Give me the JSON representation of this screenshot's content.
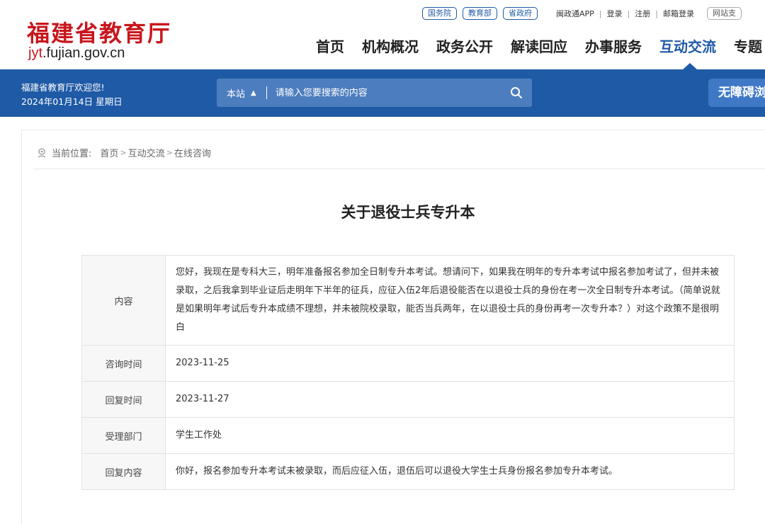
{
  "header": {
    "logo_cn": "福建省教育厅",
    "logo_domain_accent": "jyt",
    "logo_domain_rest": ".fujian.gov.cn",
    "top_pills": [
      "国务院",
      "教育部",
      "省政府"
    ],
    "top_links": [
      "闽政通APP",
      "登录",
      "注册",
      "邮箱登录"
    ],
    "top_right_pill": "网站支",
    "nav": [
      "首页",
      "机构概况",
      "政务公开",
      "解读回应",
      "办事服务",
      "互动交流",
      "专题"
    ]
  },
  "band": {
    "welcome": "福建省教育厅欢迎您!",
    "date": "2024年01月14日 星期日",
    "search_scope": "本站",
    "search_placeholder": "请输入您要搜索的内容",
    "accessibility": "无障碍浏"
  },
  "breadcrumb": {
    "prefix": "当前位置:",
    "items": [
      "首页",
      "互动交流",
      "在线咨询"
    ]
  },
  "article": {
    "title": "关于退役士兵专升本",
    "rows": [
      {
        "label": "内容",
        "value": "您好，我现在是专科大三，明年准备报名参加全日制专升本考试。想请问下，如果我在明年的专升本考试中报名参加考试了，但并未被录取，之后我拿到毕业证后走明年下半年的征兵，应征入伍2年后退役能否在以退役士兵的身份在考一次全日制专升本考试。（简单说就是如果明年考试后专升本成绩不理想，并未被院校录取，能否当兵两年，在以退役士兵的身份再考一次专升本？）对这个政策不是很明白"
      },
      {
        "label": "咨询时间",
        "value": "2023-11-25"
      },
      {
        "label": "回复时间",
        "value": "2023-11-27"
      },
      {
        "label": "受理部门",
        "value": "学生工作处"
      },
      {
        "label": "回复内容",
        "value": "你好，报名参加专升本考试未被录取，而后应征入伍，退伍后可以退役大学生士兵身份报名参加专升本考试。"
      }
    ]
  },
  "colors": {
    "brand_blue": "#1f5aa6",
    "logo_red": "#c8161d"
  }
}
